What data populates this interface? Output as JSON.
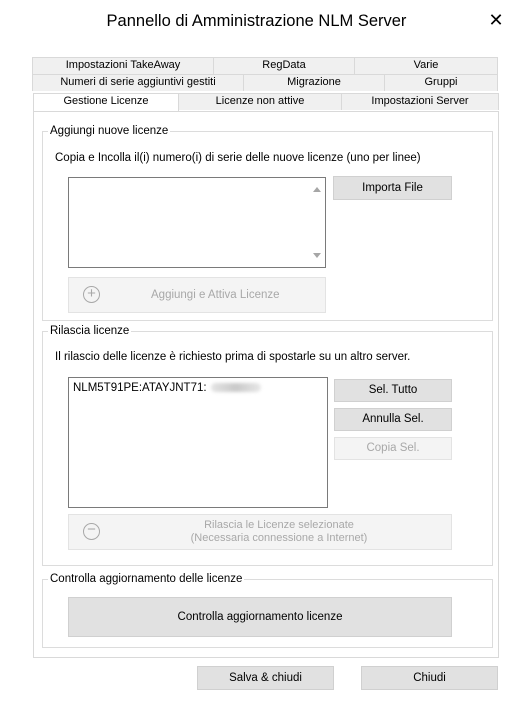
{
  "window": {
    "title": "Pannello di Amministrazione NLM Server"
  },
  "tabs": {
    "row1": [
      "Impostazioni TakeAway",
      "RegData",
      "Varie"
    ],
    "row2": [
      "Numeri di serie aggiuntivi gestiti",
      "Migrazione",
      "Gruppi"
    ],
    "row3": [
      "Gestione Licenze",
      "Licenze non attive",
      "Impostazioni Server"
    ],
    "active": "Gestione Licenze"
  },
  "add_group": {
    "legend": "Aggiungi nuove licenze",
    "instruction": "Copia e Incolla il(i) numero(i) di serie delle nuove licenze (uno per linee)",
    "textarea_value": "",
    "import_button": "Importa File",
    "add_button": "Aggiungi e Attiva Licenze"
  },
  "release_group": {
    "legend": "Rilascia licenze",
    "instruction": "Il rilascio delle licenze è richiesto prima di spostarle su un altro server.",
    "list_items": [
      "NLM5T91PE:ATAYJNT71:"
    ],
    "select_all_button": "Sel. Tutto",
    "deselect_button": "Annulla Sel.",
    "copy_button": "Copia Sel.",
    "release_button_line1": "Rilascia le Licenze selezionate",
    "release_button_line2": "(Necessaria connessione a Internet)"
  },
  "update_group": {
    "legend": "Controlla aggiornamento delle licenze",
    "check_button": "Controlla aggiornamento licenze"
  },
  "footer": {
    "save_close": "Salva & chiudi",
    "close": "Chiudi"
  },
  "icons": {
    "close": "close-icon",
    "add": "plus-circle-icon",
    "remove": "minus-circle-icon"
  }
}
